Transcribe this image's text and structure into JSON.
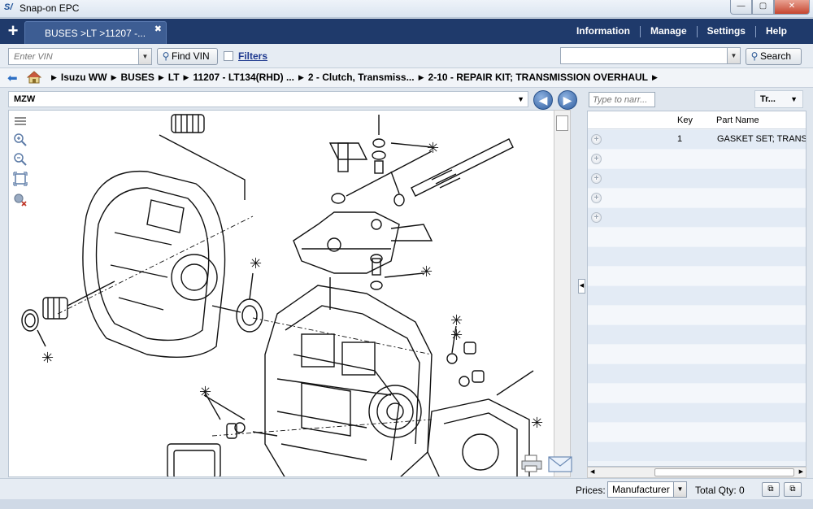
{
  "window": {
    "title": "Snap-on EPC",
    "min": "—",
    "max": "▢",
    "close": "✕"
  },
  "nav": {
    "plus": "+",
    "tab_label": "BUSES >LT >11207 -...",
    "tab_close": "✖",
    "menu": [
      "Information",
      "Manage",
      "Settings",
      "Help"
    ]
  },
  "toolbar": {
    "vin_placeholder": "Enter VIN",
    "find_vin_label": "Find VIN",
    "filters_label": "Filters",
    "search_value": "",
    "search_label": "Search"
  },
  "breadcrumb": {
    "items": [
      "Isuzu WW",
      "BUSES",
      "LT",
      "11207 - LT134(RHD) ...",
      "2 - Clutch, Transmiss...",
      "2-10 - REPAIR KIT; TRANSMISSION OVERHAUL"
    ]
  },
  "diagram_header": {
    "model": "MZW"
  },
  "parts_panel": {
    "narr_placeholder": "Type to narr...",
    "tr_label": "Tr...",
    "columns": {
      "key": "Key",
      "name": "Part Name"
    },
    "rows": [
      {
        "key": "1",
        "name": "GASKET SET; TRANS ("
      },
      {
        "key": "",
        "name": ""
      },
      {
        "key": "",
        "name": ""
      },
      {
        "key": "",
        "name": ""
      },
      {
        "key": "",
        "name": ""
      }
    ]
  },
  "status": {
    "prices_label": "Prices:",
    "prices_value": "Manufacturer",
    "total_qty": "Total Qty: 0"
  },
  "colors": {
    "navbar": "#1f3a6b",
    "tab": "#3d5d93",
    "link": "#1f3a8f"
  }
}
